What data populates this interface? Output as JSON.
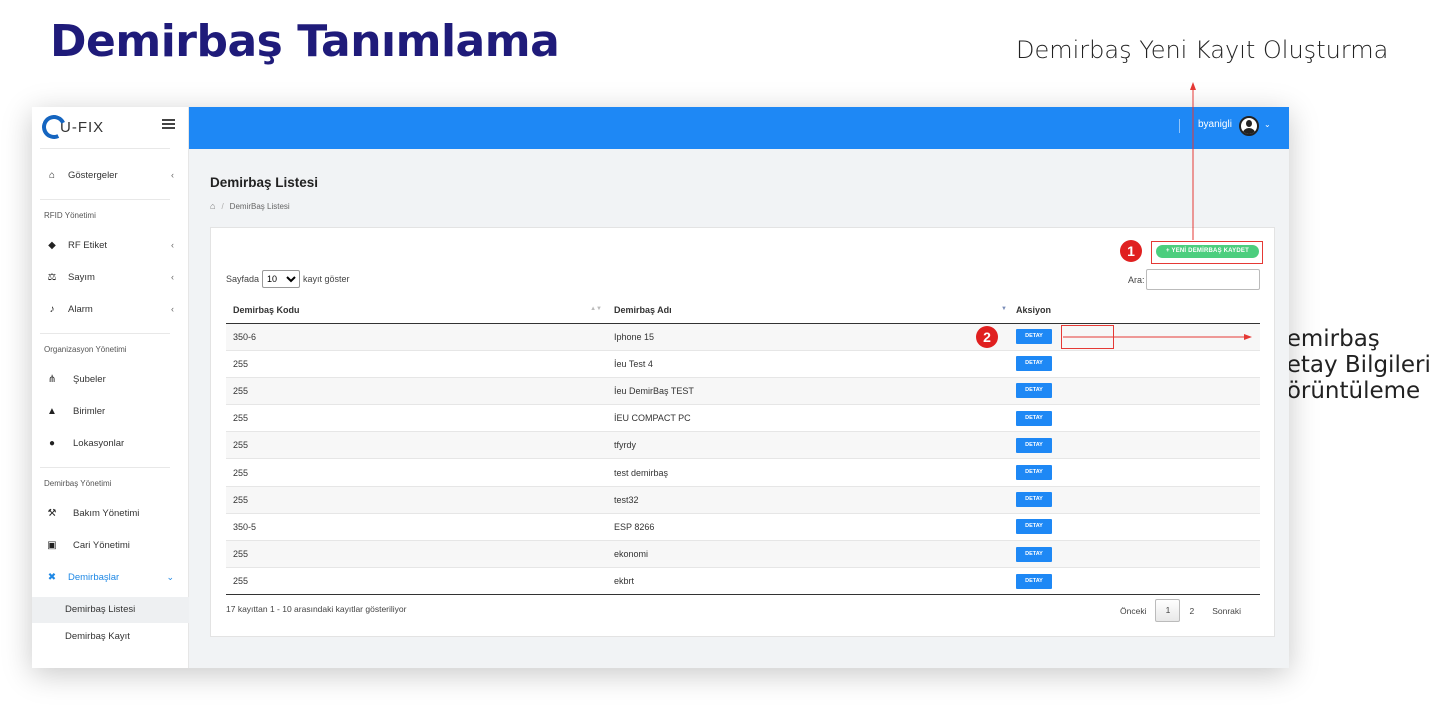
{
  "annotations": {
    "page_title": "Demirbaş Tanımlama",
    "top_note": "Demirbaş Yeni Kayıt Oluşturma",
    "right_note": [
      "Demirbaş",
      "Detay Bilgileri",
      "Görüntüleme"
    ],
    "badge_1": "1",
    "badge_2": "2",
    "accent_color": "#e53935"
  },
  "app": {
    "logo": "U-FIX",
    "user": "byanigli",
    "brand_color": "#1e88f5"
  },
  "sidebar": {
    "gostergeler": "Göstergeler",
    "section_rfid": "RFID Yönetimi",
    "rf_etiket": "RF Etiket",
    "sayim": "Sayım",
    "alarm": "Alarm",
    "section_org": "Organizasyon Yönetimi",
    "subeler": "Şubeler",
    "birimler": "Birimler",
    "lokasyonlar": "Lokasyonlar",
    "section_demirbas": "Demirbaş Yönetimi",
    "bakim": "Bakım Yönetimi",
    "cari": "Cari Yönetimi",
    "demirbaslar": "Demirbaşlar",
    "sub_liste": "Demirbaş Listesi",
    "sub_kayit": "Demirbaş Kayıt"
  },
  "content": {
    "title": "Demirbaş Listesi",
    "breadcrumb": "DemirBaş Listesi",
    "new_button": "+ YENİ DEMİRBAŞ KAYDET",
    "length_prefix": "Sayfada",
    "length_value": "10",
    "length_suffix": "kayıt göster",
    "search_label": "Ara:",
    "col_code": "Demirbaş Kodu",
    "col_name": "Demirbaş Adı",
    "col_action": "Aksiyon",
    "detail_label": "DETAY",
    "rows": [
      {
        "code": "350-6",
        "name": "Iphone 15"
      },
      {
        "code": "255",
        "name": "İeu Test 4"
      },
      {
        "code": "255",
        "name": "İeu DemirBaş TEST"
      },
      {
        "code": "255",
        "name": "İEU COMPACT PC"
      },
      {
        "code": "255",
        "name": "tfyrdy"
      },
      {
        "code": "255",
        "name": "test demirbaş"
      },
      {
        "code": "255",
        "name": "test32"
      },
      {
        "code": "350-5",
        "name": "ESP 8266"
      },
      {
        "code": "255",
        "name": "ekonomi"
      },
      {
        "code": "255",
        "name": "ekbrt"
      }
    ],
    "info": "17 kayıttan 1 - 10 arasındaki kayıtlar gösteriliyor",
    "pager_prev": "Önceki",
    "pager_page1": "1",
    "pager_page2": "2",
    "pager_next": "Sonraki"
  }
}
